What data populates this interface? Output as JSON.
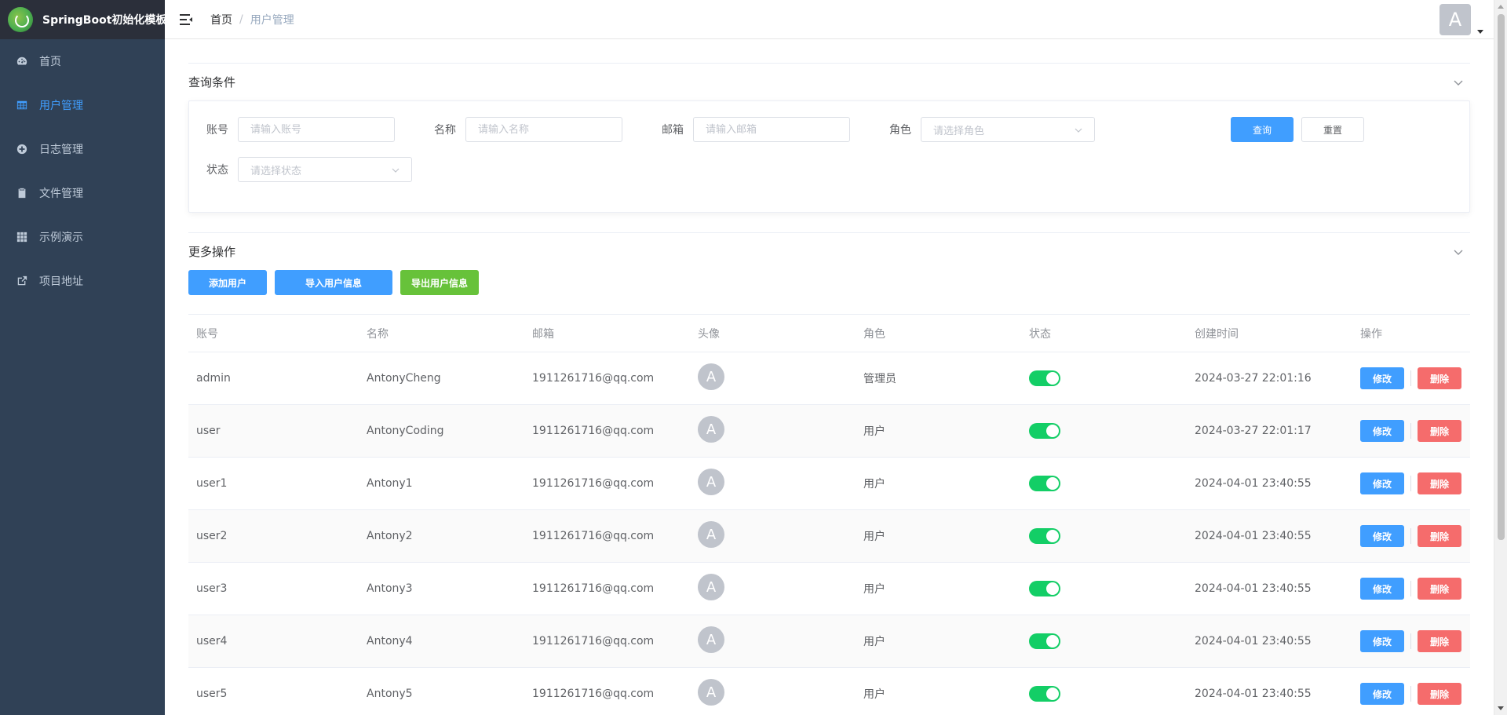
{
  "app": {
    "title": "SpringBoot初始化模板"
  },
  "sidebar": {
    "items": [
      {
        "label": "首页",
        "icon": "dashboard-icon",
        "active": false
      },
      {
        "label": "用户管理",
        "icon": "table-icon",
        "active": true
      },
      {
        "label": "日志管理",
        "icon": "log-icon",
        "active": false
      },
      {
        "label": "文件管理",
        "icon": "clipboard-icon",
        "active": false
      },
      {
        "label": "示例演示",
        "icon": "grid-icon",
        "active": false
      },
      {
        "label": "项目地址",
        "icon": "external-link-icon",
        "active": false
      }
    ]
  },
  "header": {
    "breadcrumb": {
      "home": "首页",
      "separator": "/",
      "current": "用户管理"
    },
    "avatar_letter": "A"
  },
  "query": {
    "title": "查询条件",
    "account_label": "账号",
    "account_placeholder": "请输入账号",
    "name_label": "名称",
    "name_placeholder": "请输入名称",
    "email_label": "邮箱",
    "email_placeholder": "请输入邮箱",
    "role_label": "角色",
    "role_placeholder": "请选择角色",
    "status_label": "状态",
    "status_placeholder": "请选择状态",
    "search_button": "查询",
    "reset_button": "重置"
  },
  "ops": {
    "title": "更多操作",
    "add_button": "添加用户",
    "import_button": "导入用户信息",
    "export_button": "导出用户信息"
  },
  "table": {
    "columns": [
      "账号",
      "名称",
      "邮箱",
      "头像",
      "角色",
      "状态",
      "创建时间",
      "操作"
    ],
    "edit_label": "修改",
    "delete_label": "删除",
    "rows": [
      {
        "account": "admin",
        "name": "AntonyCheng",
        "email": "1911261716@qq.com",
        "avatar": "A",
        "role": "管理员",
        "enabled": true,
        "created": "2024-03-27 22:01:16"
      },
      {
        "account": "user",
        "name": "AntonyCoding",
        "email": "1911261716@qq.com",
        "avatar": "A",
        "role": "用户",
        "enabled": true,
        "created": "2024-03-27 22:01:17"
      },
      {
        "account": "user1",
        "name": "Antony1",
        "email": "1911261716@qq.com",
        "avatar": "A",
        "role": "用户",
        "enabled": true,
        "created": "2024-04-01 23:40:55"
      },
      {
        "account": "user2",
        "name": "Antony2",
        "email": "1911261716@qq.com",
        "avatar": "A",
        "role": "用户",
        "enabled": true,
        "created": "2024-04-01 23:40:55"
      },
      {
        "account": "user3",
        "name": "Antony3",
        "email": "1911261716@qq.com",
        "avatar": "A",
        "role": "用户",
        "enabled": true,
        "created": "2024-04-01 23:40:55"
      },
      {
        "account": "user4",
        "name": "Antony4",
        "email": "1911261716@qq.com",
        "avatar": "A",
        "role": "用户",
        "enabled": true,
        "created": "2024-04-01 23:40:55"
      },
      {
        "account": "user5",
        "name": "Antony5",
        "email": "1911261716@qq.com",
        "avatar": "A",
        "role": "用户",
        "enabled": true,
        "created": "2024-04-01 23:40:55"
      }
    ]
  },
  "colors": {
    "sidebar_bg": "#304156",
    "accent": "#409eff",
    "success": "#67c23a",
    "danger": "#f56c6c",
    "switch_on": "#13ce66"
  }
}
